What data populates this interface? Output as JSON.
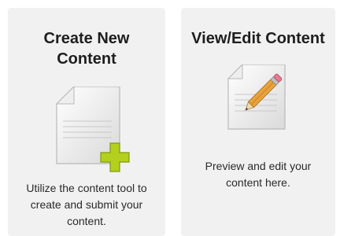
{
  "cards": [
    {
      "title": "Create New Content",
      "description": "Utilize the content tool to create and submit your content.",
      "icon": "document-add-icon"
    },
    {
      "title": "View/Edit Content",
      "description": "Preview and edit your content here.",
      "icon": "document-edit-icon"
    }
  ],
  "colors": {
    "card_background": "#f1f1f1",
    "plus_accent": "#b5cf1e",
    "pencil_body": "#e8a33b"
  }
}
